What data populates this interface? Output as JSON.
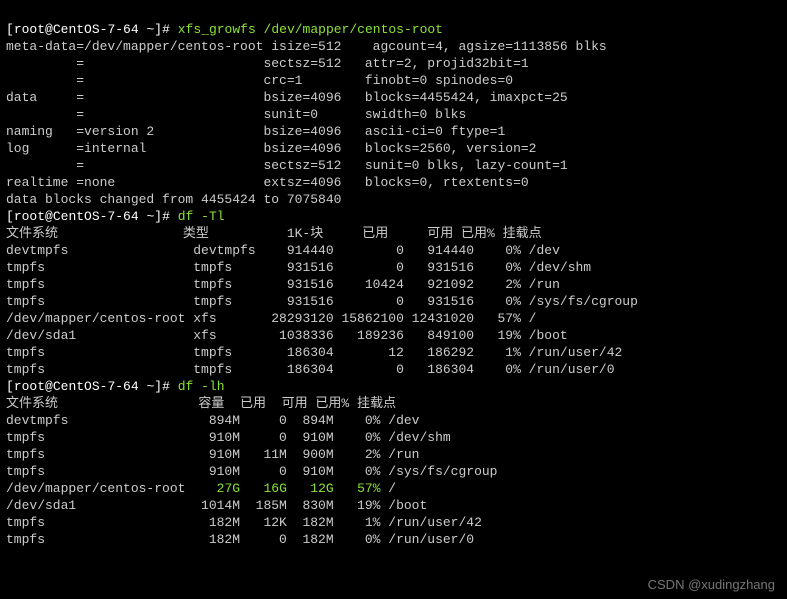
{
  "prompt": {
    "user": "root",
    "host": "CentOS-7-64",
    "path": "~",
    "pchar": "#"
  },
  "cmd": {
    "xfs_growfs": "xfs_growfs /dev/mapper/centos-root",
    "df_tl": "df -Tl",
    "df_lh": "df -lh"
  },
  "xfs": {
    "lines": [
      "meta-data=/dev/mapper/centos-root isize=512    agcount=4, agsize=1113856 blks",
      "         =                       sectsz=512   attr=2, projid32bit=1",
      "         =                       crc=1        finobt=0 spinodes=0",
      "data     =                       bsize=4096   blocks=4455424, imaxpct=25",
      "         =                       sunit=0      swidth=0 blks",
      "naming   =version 2              bsize=4096   ascii-ci=0 ftype=1",
      "log      =internal               bsize=4096   blocks=2560, version=2",
      "         =                       sectsz=512   sunit=0 blks, lazy-count=1",
      "realtime =none                   extsz=4096   blocks=0, rtextents=0",
      "data blocks changed from 4455424 to 7075840"
    ]
  },
  "df_tl": {
    "header": "文件系统                类型          1K-块     已用     可用 已用% 挂载点",
    "rows": [
      "devtmpfs                devtmpfs    914440        0   914440    0% /dev",
      "tmpfs                   tmpfs       931516        0   931516    0% /dev/shm",
      "tmpfs                   tmpfs       931516    10424   921092    2% /run",
      "tmpfs                   tmpfs       931516        0   931516    0% /sys/fs/cgroup",
      "/dev/mapper/centos-root xfs       28293120 15862100 12431020   57% /",
      "/dev/sda1               xfs        1038336   189236   849100   19% /boot",
      "tmpfs                   tmpfs       186304       12   186292    1% /run/user/42",
      "tmpfs                   tmpfs       186304        0   186304    0% /run/user/0"
    ]
  },
  "df_lh": {
    "header": "文件系统                  容量  已用  可用 已用% 挂载点",
    "rows": [
      "devtmpfs                  894M     0  894M    0% /dev",
      "tmpfs                     910M     0  910M    0% /dev/shm",
      "tmpfs                     910M   11M  900M    2% /run",
      "tmpfs                     910M     0  910M    0% /sys/fs/cgroup"
    ],
    "highlight": {
      "fs": "/dev/mapper/centos-root   ",
      "size": " 27G",
      "used": "   16G",
      "avail": "   12G",
      "pct": "   57%",
      "mnt": " /"
    },
    "rows_after": [
      "/dev/sda1                1014M  185M  830M   19% /boot",
      "tmpfs                     182M   12K  182M    1% /run/user/42",
      "tmpfs                     182M     0  182M    0% /run/user/0"
    ]
  },
  "watermark": "CSDN @xudingzhang"
}
